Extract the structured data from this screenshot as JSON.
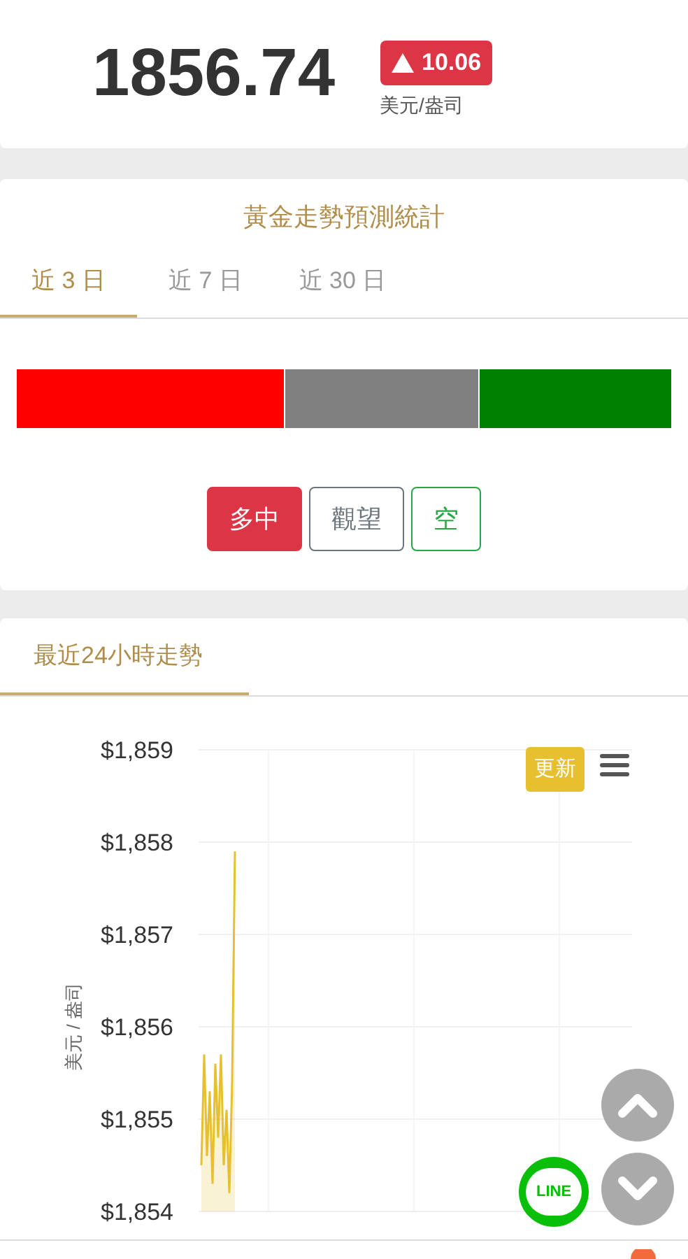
{
  "quote": {
    "price": "1856.74",
    "change": "10.06",
    "unit": "美元/盎司"
  },
  "forecast": {
    "title": "黃金走勢預測統計",
    "tabs": [
      {
        "label": "近 3 日",
        "selected": true
      },
      {
        "label": "近 7 日",
        "selected": false
      },
      {
        "label": "近 30 日",
        "selected": false
      }
    ],
    "segments": [
      {
        "color": "#ff0000"
      },
      {
        "color": "#808080"
      },
      {
        "color": "#008000"
      }
    ],
    "buttons": [
      {
        "label": "多中",
        "kind": "bull",
        "selected": true
      },
      {
        "label": "觀望",
        "kind": "neutral",
        "selected": false
      },
      {
        "label": "空",
        "kind": "bear",
        "selected": false
      }
    ]
  },
  "trend": {
    "tab": {
      "label": "最近24小時走勢",
      "selected": true
    },
    "refresh_button": "更新",
    "chart": {
      "ylabel": "美元 / 盎司",
      "y_axis_labels": [
        "$1,859",
        "$1,858",
        "$1,857",
        "$1,856",
        "$1,855",
        "$1,854"
      ]
    }
  },
  "line_button": {
    "label": "LINE"
  }
}
